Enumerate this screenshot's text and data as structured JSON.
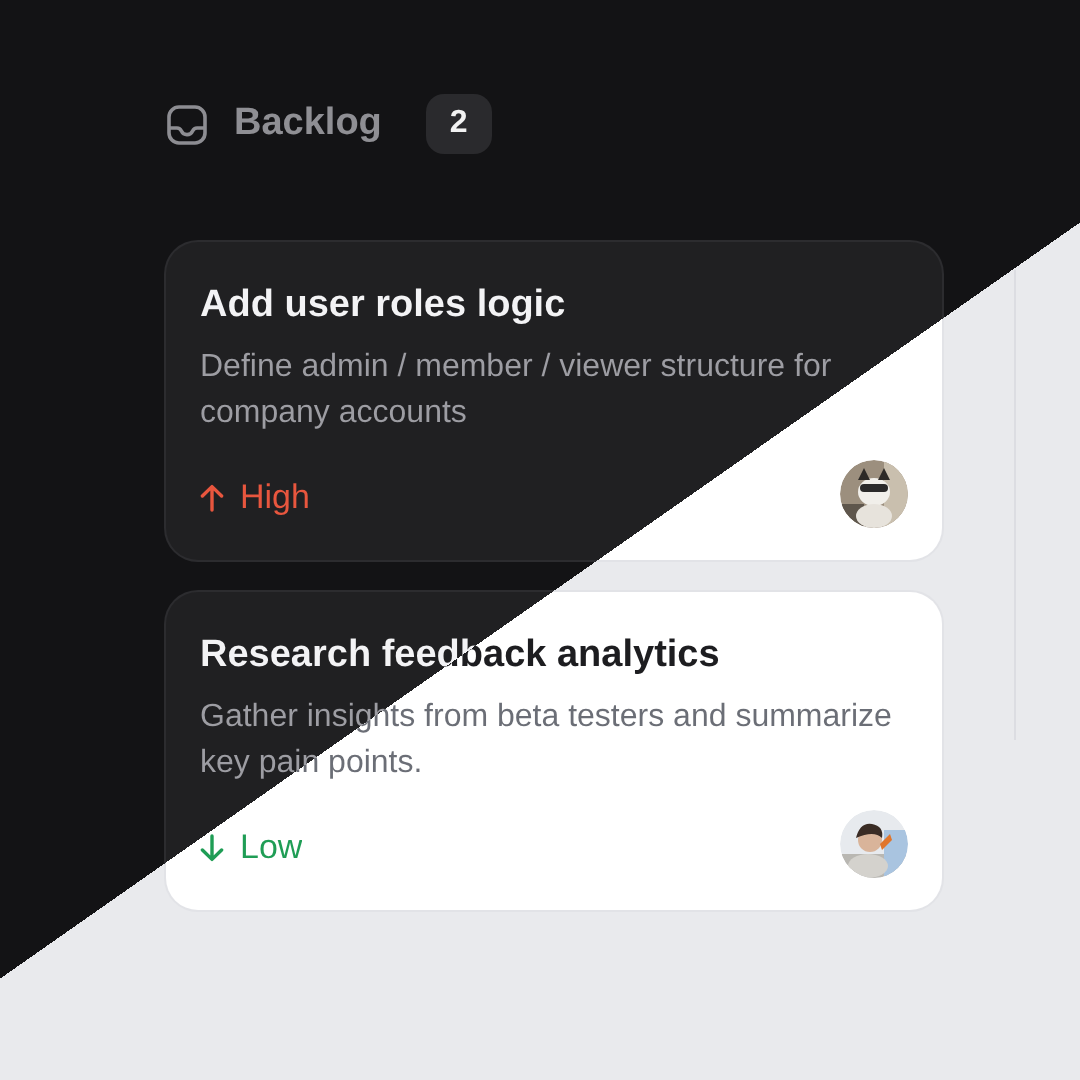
{
  "column": {
    "title": "Backlog",
    "count": "2"
  },
  "cards": [
    {
      "title": "Add user roles logic",
      "description": "Define admin / member / viewer structure for company accounts",
      "priority": {
        "label": "High",
        "kind": "high"
      }
    },
    {
      "title": "Research feedback analytics",
      "description": "Gather insights from beta testers and summarize key pain points.",
      "priority": {
        "label": "Low",
        "kind": "low"
      }
    }
  ]
}
